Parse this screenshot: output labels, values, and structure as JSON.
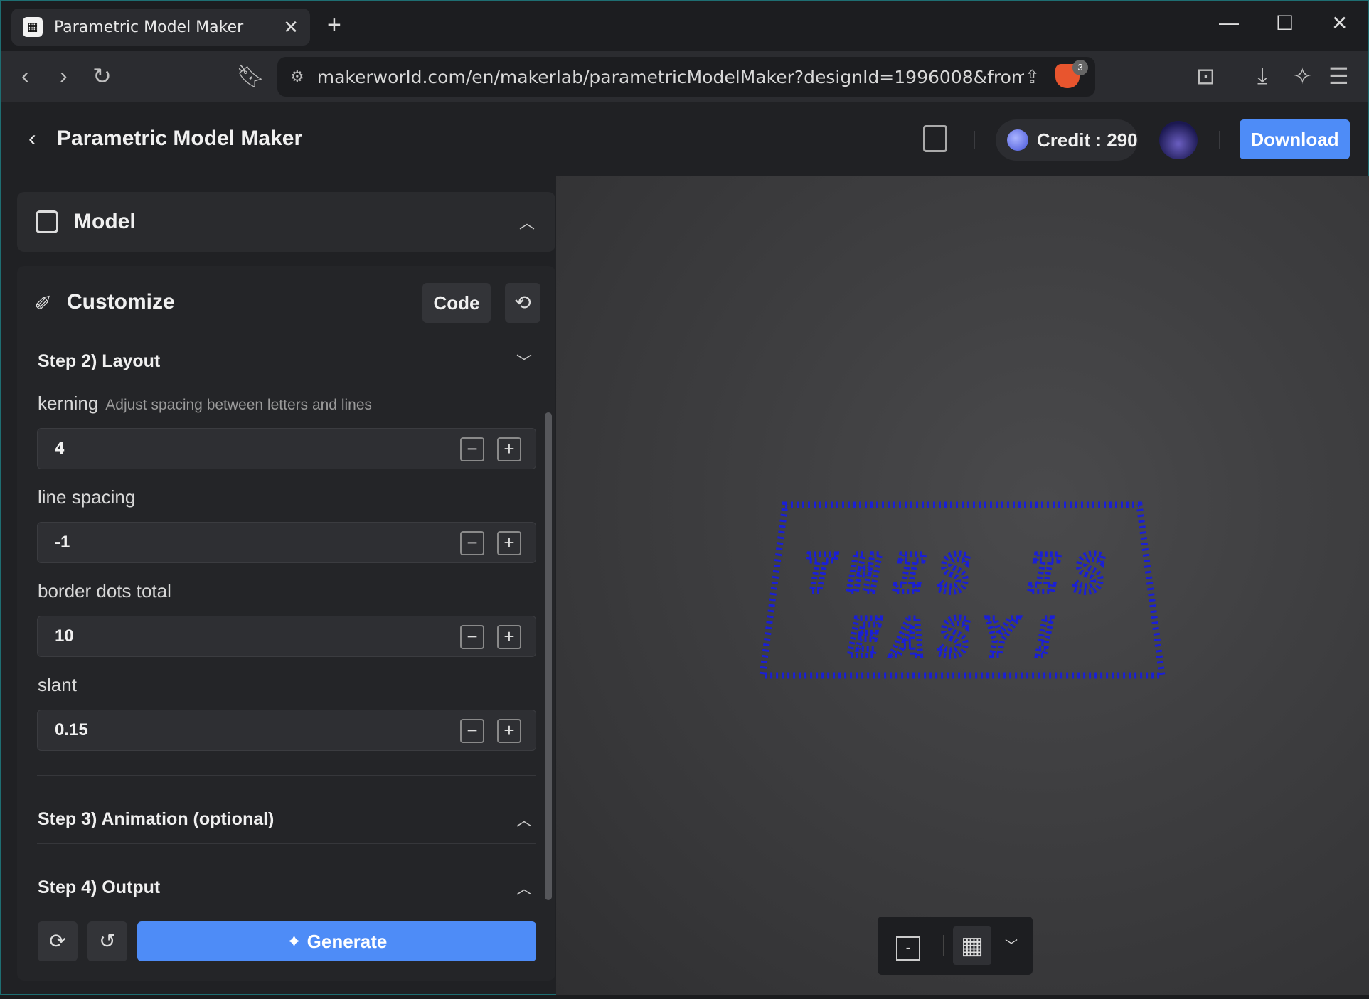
{
  "browser": {
    "tab_title": "Parametric Model Maker",
    "url": "makerworld.com/en/makerlab/parametricModelMaker?designId=1996008&from=mo...",
    "brave_badge": "3"
  },
  "app": {
    "title": "Parametric Model Maker",
    "credit_label": "Credit : 290",
    "download_label": "Download"
  },
  "model_section": {
    "label": "Model"
  },
  "customize": {
    "title": "Customize",
    "code_label": "Code",
    "step2_title": "Step 2) Layout",
    "fields": [
      {
        "label": "kerning",
        "hint": "Adjust spacing between letters and lines",
        "value": "4"
      },
      {
        "label": "line spacing",
        "hint": "",
        "value": "-1"
      },
      {
        "label": "border dots total",
        "hint": "",
        "value": "10"
      },
      {
        "label": "slant",
        "hint": "",
        "value": "0.15"
      }
    ],
    "step3_title": "Step 3) Animation (optional)",
    "step4_title": "Step 4) Output",
    "generate_label": "Generate"
  },
  "preview": {
    "line1": "THIS IS",
    "line2": "EASY!",
    "text_color": "#1a1fd6",
    "view_toggle": "-"
  },
  "colors": {
    "accent": "#4e8cf7",
    "panel": "#242528"
  }
}
